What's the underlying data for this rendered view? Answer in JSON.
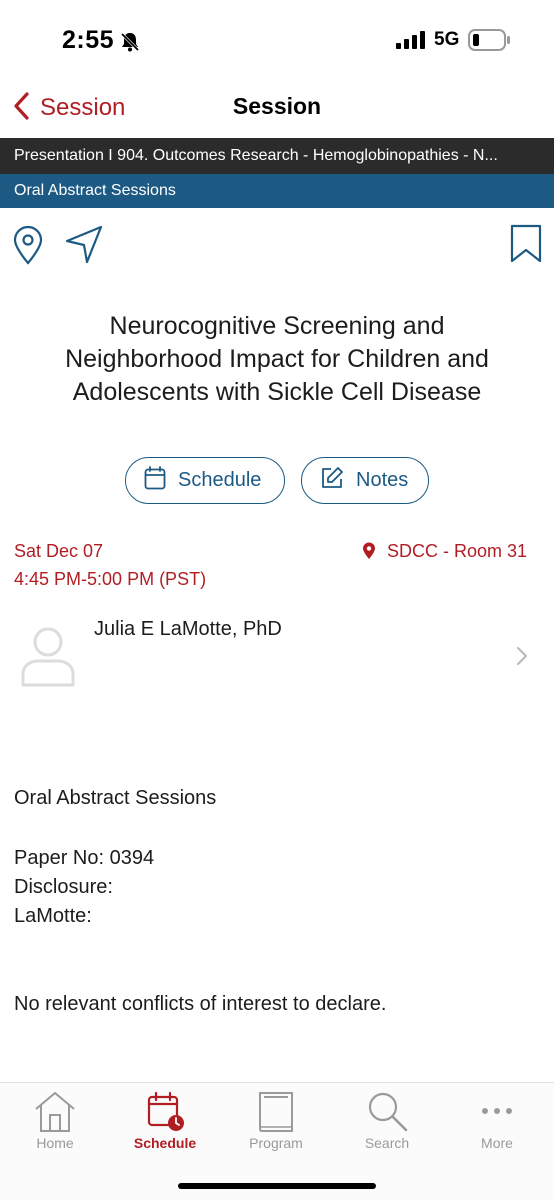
{
  "status_bar": {
    "time": "2:55",
    "network": "5G"
  },
  "nav": {
    "back_label": "Session",
    "title": "Session"
  },
  "track_bar": "Presentation I 904. Outcomes Research -  Hemoglobinopathies -  N...",
  "session_type_bar": "Oral Abstract Sessions",
  "abstract": {
    "title_lines": [
      "Neurocognitive Screening and",
      "Neighborhood Impact for Children and",
      "Adolescents with Sickle Cell Disease"
    ]
  },
  "buttons": {
    "schedule": "Schedule",
    "notes": "Notes"
  },
  "event": {
    "date": "Sat Dec 07",
    "time": "4:45 PM-5:00 PM (PST)",
    "location": "SDCC - Room 31"
  },
  "speaker": {
    "name": "Julia E LaMotte, PhD"
  },
  "details": {
    "session_type": "Oral Abstract Sessions",
    "paper_no": "Paper No: 0394",
    "disclosure_label": "Disclosure:",
    "disclosure_name": "LaMotte:",
    "disclosure_text": "No relevant conflicts of interest to declare."
  },
  "tabs": [
    {
      "label": "Home",
      "icon": "home-icon",
      "active": false
    },
    {
      "label": "Schedule",
      "icon": "calendar-clock-icon",
      "active": true
    },
    {
      "label": "Program",
      "icon": "book-icon",
      "active": false
    },
    {
      "label": "Search",
      "icon": "search-icon",
      "active": false
    },
    {
      "label": "More",
      "icon": "more-dots-icon",
      "active": false
    }
  ],
  "colors": {
    "accent_red": "#b01e24",
    "brand_blue": "#1c5a84",
    "track_bar_bg": "#2b2b2b",
    "inactive_tab": "#9a9a9a"
  }
}
